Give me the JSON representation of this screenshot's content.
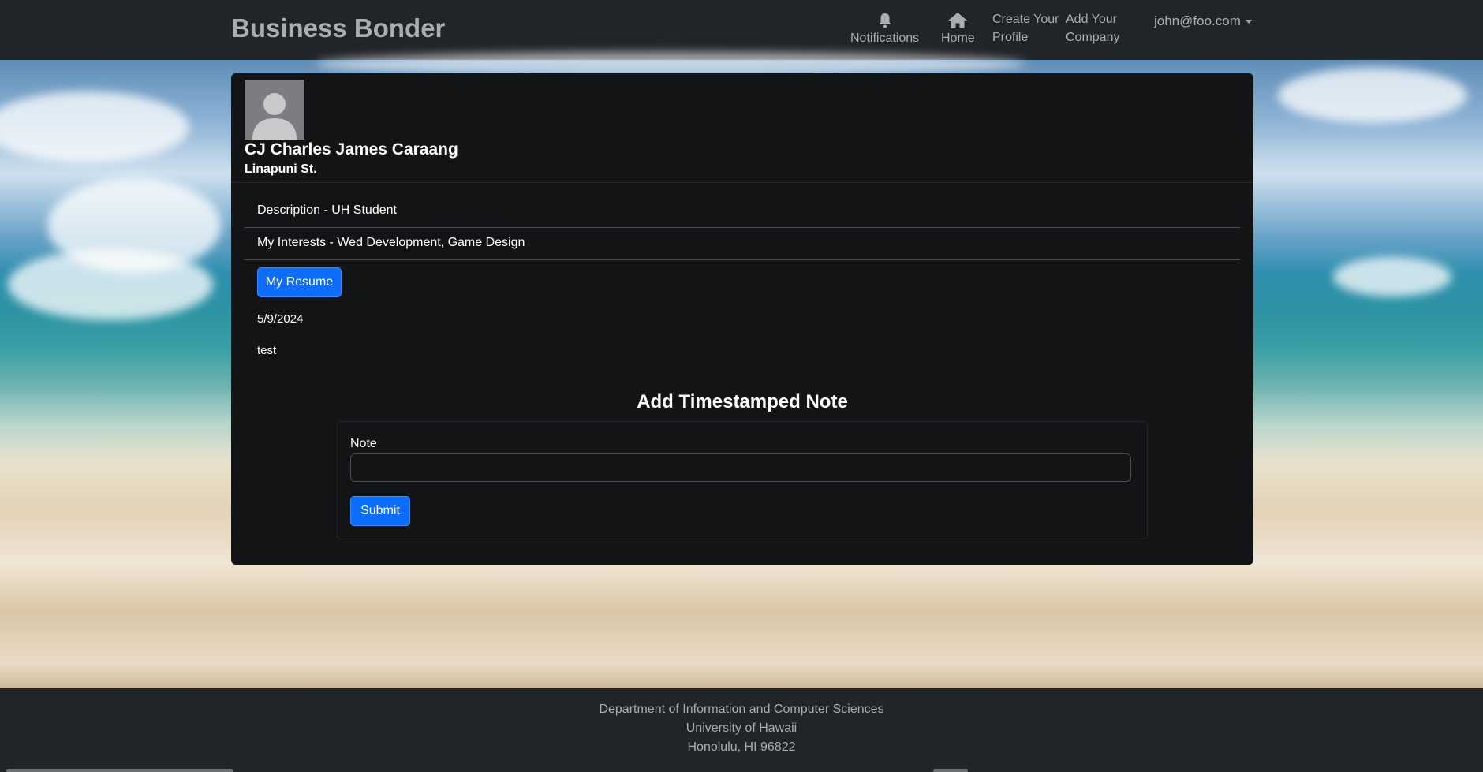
{
  "navbar": {
    "brand": "Business Bonder",
    "notifications_label": "Notifications",
    "home_label": "Home",
    "create_profile_line1": "Create Your",
    "create_profile_line2": "Profile",
    "add_company_line1": "Add Your",
    "add_company_line2": "Company",
    "user_email": "john@foo.com"
  },
  "profile": {
    "name": "CJ Charles James Caraang",
    "street": "Linapuni St.",
    "description": "Description - UH Student",
    "interests": "My Interests - Wed Development, Game Design",
    "resume_button": "My Resume",
    "note_date": "5/9/2024",
    "note_text": "test"
  },
  "note_form": {
    "title": "Add Timestamped Note",
    "note_label": "Note",
    "note_value": "",
    "submit_label": "Submit"
  },
  "footer": {
    "line1": "Department of Information and Computer Sciences",
    "line2": "University of Hawaii",
    "line3": "Honolulu, HI 96822"
  },
  "colors": {
    "navbar_bg": "#212529",
    "card_bg": "#131416",
    "primary_button": "#0d6efd"
  }
}
